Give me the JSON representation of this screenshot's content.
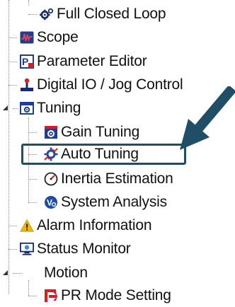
{
  "tree": {
    "items": [
      {
        "label": "Full Closed Loop",
        "icon": "gear-icon"
      },
      {
        "label": "Scope",
        "icon": "scope-waveform-icon"
      },
      {
        "label": "Parameter Editor",
        "icon": "parameter-editor-icon"
      },
      {
        "label": "Digital IO / Jog Control",
        "icon": "jog-control-icon"
      },
      {
        "label": "Tuning",
        "icon": "tuning-icon"
      },
      {
        "label": "Gain Tuning",
        "icon": "gain-tuning-icon"
      },
      {
        "label": "Auto Tuning",
        "icon": "auto-tuning-icon"
      },
      {
        "label": "Inertia Estimation",
        "icon": "gauge-icon"
      },
      {
        "label": "System Analysis",
        "icon": "system-analysis-icon"
      },
      {
        "label": "Alarm Information",
        "icon": "warning-icon"
      },
      {
        "label": "Status Monitor",
        "icon": "monitor-icon"
      },
      {
        "label": "Motion",
        "icon": ""
      },
      {
        "label": "PR Mode Setting",
        "icon": "pr-mode-icon"
      }
    ]
  },
  "highlight": {
    "selected": "Auto Tuning",
    "color": "#1f4e66"
  },
  "colors": {
    "arrow": "#1f4e66",
    "warning": "#f2b705",
    "accent_blue": "#1e4aa8",
    "accent_red": "#d42020"
  }
}
